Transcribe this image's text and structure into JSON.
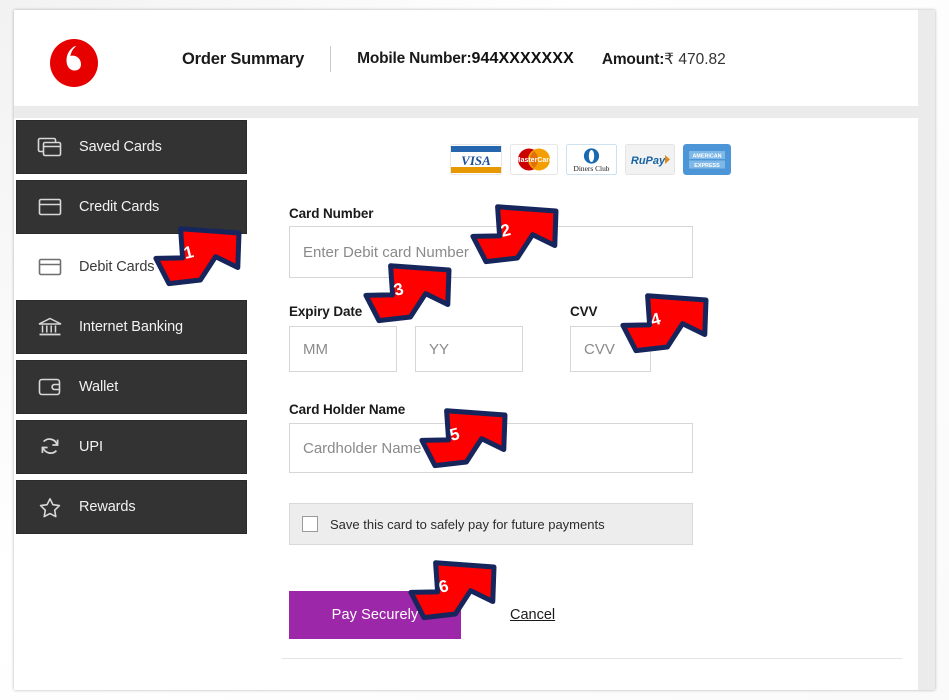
{
  "header": {
    "logo_icon": "vodafone-speechmark-logo",
    "order_summary_title": "Order Summary",
    "mobile_label": "Mobile Number:",
    "mobile_value": "944XXXXXXX",
    "amount_label": "Amount:",
    "amount_value": "₹ 470.82"
  },
  "sidebar": {
    "items": [
      {
        "label": "Saved Cards",
        "icon": "stacked-cards-icon",
        "active": false
      },
      {
        "label": "Credit Cards",
        "icon": "credit-card-icon",
        "active": false
      },
      {
        "label": "Debit Cards",
        "icon": "debit-card-icon",
        "active": true
      },
      {
        "label": "Internet Banking",
        "icon": "bank-icon",
        "active": false
      },
      {
        "label": "Wallet",
        "icon": "wallet-icon",
        "active": false
      },
      {
        "label": "UPI",
        "icon": "refresh-arrows-icon",
        "active": false
      },
      {
        "label": "Rewards",
        "icon": "star-icon",
        "active": false
      }
    ]
  },
  "payment_form": {
    "accepted_cards": [
      {
        "name": "visa-logo",
        "label": "VISA"
      },
      {
        "name": "mastercard-logo",
        "label": "MasterCard"
      },
      {
        "name": "diners-club-logo",
        "label": "Diners Club"
      },
      {
        "name": "rupay-logo",
        "label": "RuPay"
      },
      {
        "name": "american-express-logo",
        "label": "AMERICAN EXPRESS"
      }
    ],
    "card_number_label": "Card Number",
    "card_number_value": "",
    "card_number_placeholder": "Enter Debit card Number",
    "expiry_label": "Expiry Date",
    "expiry_month_value": "",
    "expiry_month_placeholder": "MM",
    "expiry_year_value": "",
    "expiry_year_placeholder": "YY",
    "cvv_label": "CVV",
    "cvv_value": "",
    "cvv_placeholder": "CVV",
    "holder_label": "Card Holder Name",
    "holder_value": "",
    "holder_placeholder": "Cardholder Name",
    "save_card_text": "Save this card to safely pay for future payments",
    "save_card_checked": false,
    "pay_button_label": "Pay Securely",
    "cancel_label": "Cancel"
  },
  "annotations": [
    {
      "number": "1",
      "target": "sidebar-item-debit-cards"
    },
    {
      "number": "2",
      "target": "card-number-input"
    },
    {
      "number": "3",
      "target": "expiry-date-fields"
    },
    {
      "number": "4",
      "target": "cvv-input"
    },
    {
      "number": "5",
      "target": "card-holder-name-input"
    },
    {
      "number": "6",
      "target": "pay-securely-button"
    }
  ],
  "colors": {
    "brand_red": "#E60000",
    "sidebar_dark": "#333333",
    "pay_button_purple": "#9C27A8",
    "arrow_red": "#FF0000",
    "arrow_outline_navy": "#16265C"
  }
}
